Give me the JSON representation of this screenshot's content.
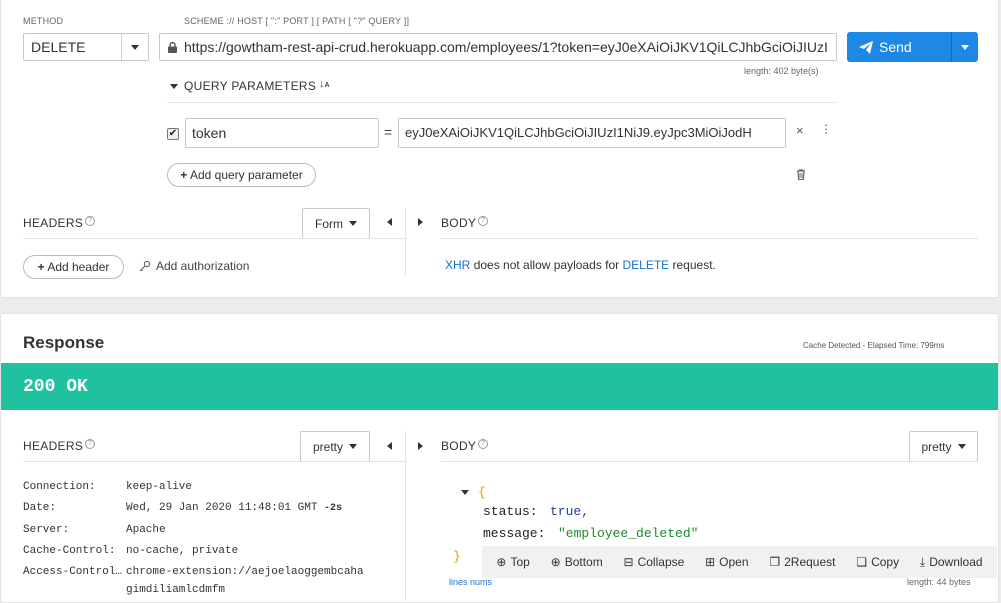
{
  "request": {
    "method_label": "METHOD",
    "method_value": "DELETE",
    "url_label": "SCHEME :// HOST [ \":\" PORT ] [ PATH [ \"?\" QUERY ]]",
    "url_value": "https://gowtham-rest-api-crud.herokuapp.com/employees/1?token=eyJ0eXAiOiJKV1QiLCJhbGciOiJIUzI",
    "length": "length: 402 byte(s)",
    "send_label": "Send",
    "query_title": "QUERY PARAMETERS",
    "param_name": "token",
    "param_equals": "=",
    "param_value": "eyJ0eXAiOiJKV1QiLCJhbGciOiJIUzI1NiJ9.eyJpc3MiOiJodH",
    "add_param": "Add query parameter",
    "headers_title": "HEADERS",
    "headers_format": "Form",
    "body_title": "BODY",
    "add_header": "Add header",
    "add_auth": "Add authorization",
    "body_msg_xhr": "XHR",
    "body_msg_mid": "does not allow payloads for",
    "body_msg_method": "DELETE",
    "body_msg_end": "request."
  },
  "response": {
    "title": "Response",
    "meta": "Cache Detected - Elapsed Time: 799ms",
    "status": "200 OK",
    "status_color": "#1fc19f",
    "headers_title": "HEADERS",
    "headers_format": "pretty",
    "body_title": "BODY",
    "body_format": "pretty",
    "headers": [
      {
        "key": "Connection:",
        "value": "keep-alive"
      },
      {
        "key": "Date:",
        "value": "Wed, 29 Jan 2020 11:48:01 GMT",
        "extra": "-2s"
      },
      {
        "key": "Server:",
        "value": "Apache"
      },
      {
        "key": "Cache-Control:",
        "value": "no-cache, private"
      },
      {
        "key": "Access-Control…",
        "value": "chrome-extension://aejoelaoggembcaha"
      },
      {
        "key": "",
        "value": "gimdiliamlcdmfm"
      }
    ],
    "body_open": "{",
    "body_close": "}",
    "body_lines": [
      {
        "key": "status:",
        "value": "true,"
      },
      {
        "key": "message:",
        "value": "\"employee_deleted\""
      }
    ],
    "toolbar": {
      "top": "Top",
      "bottom": "Bottom",
      "collapse": "Collapse",
      "open": "Open",
      "to_request": "2Request",
      "copy": "Copy",
      "download": "Download"
    },
    "lines_nums": "lines nums",
    "body_length": "length: 44 bytes"
  },
  "colors": {
    "accent": "#1e88e5",
    "link": "#1a73c8",
    "string": "#1a8a2e",
    "bool": "#1d3f9e"
  }
}
